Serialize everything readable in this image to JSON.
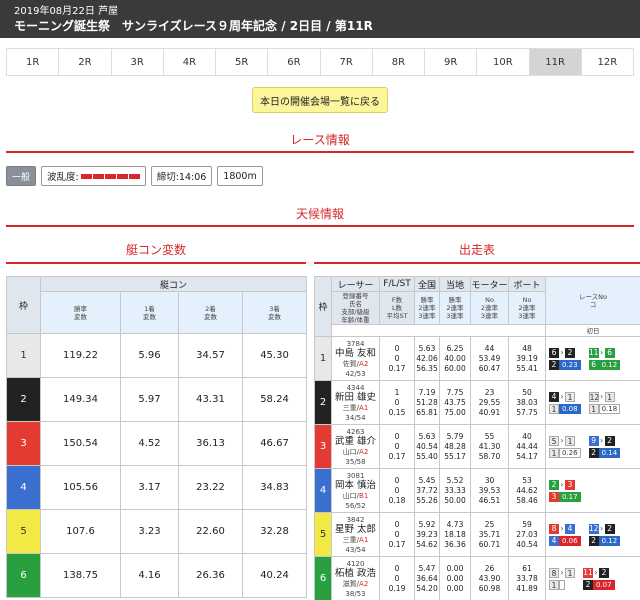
{
  "header": {
    "date_place": "2019年08月22日 芦屋",
    "title": "モーニング誕生祭　サンライズレース９周年記念 / 2日目 / 第11R"
  },
  "race_tabs": [
    "1R",
    "2R",
    "3R",
    "4R",
    "5R",
    "6R",
    "7R",
    "8R",
    "9R",
    "10R",
    "11R",
    "12R"
  ],
  "active_tab": "11R",
  "back_button": "本日の開催会場一覧に戻る",
  "sections": {
    "race_info": "レース情報",
    "weather": "天候情報",
    "boatcon": "艇コン変数",
    "entries": "出走表"
  },
  "race_chips": {
    "grade": "一般",
    "nami_label": "波乱度:",
    "nami_level": 5,
    "deadline": "締切:14:06",
    "distance": "1800m"
  },
  "left_table": {
    "header_waku": "枠",
    "header_group": "艇コン",
    "cols": [
      "勝率\n変数",
      "1着\n変数",
      "2着\n変数",
      "3着\n変数"
    ],
    "rows": [
      {
        "waku": "1",
        "v": [
          "119.22",
          "5.96",
          "34.57",
          "45.30"
        ]
      },
      {
        "waku": "2",
        "v": [
          "149.34",
          "5.97",
          "43.31",
          "58.24"
        ]
      },
      {
        "waku": "3",
        "v": [
          "150.54",
          "4.52",
          "36.13",
          "46.67"
        ]
      },
      {
        "waku": "4",
        "v": [
          "105.56",
          "3.17",
          "23.22",
          "34.83"
        ]
      },
      {
        "waku": "5",
        "v": [
          "107.6",
          "3.23",
          "22.60",
          "32.28"
        ]
      },
      {
        "waku": "6",
        "v": [
          "138.75",
          "4.16",
          "26.36",
          "40.24"
        ]
      }
    ]
  },
  "right_table": {
    "headers": {
      "waku": "枠",
      "racer": "レーサー",
      "fls": "F/L/ST",
      "national": "全国",
      "local": "当地",
      "motor": "モーター",
      "boat": "ボート",
      "last": "レースNo\nコ",
      "racer_sub": "登録番号\n氏名\n支部/級級\n年齢/体重",
      "fls_sub": "F数\nL数\n平均ST",
      "nat_sub": "勝率\n2連率\n3連率",
      "loc_sub": "勝率\n2連率\n3連率",
      "motor_sub": "No\n2連率\n3連率",
      "boat_sub": "No\n2連率\n3連率",
      "day1": "初日"
    },
    "rows": [
      {
        "waku": "1",
        "no": "3784",
        "name": "中島 友和",
        "branch": "佐賀/",
        "cls": "A2",
        "age": "42/53",
        "fls": [
          "0",
          "0",
          "0.17"
        ],
        "nat": [
          "5.63",
          "42.06",
          "56.35"
        ],
        "loc": [
          "6.25",
          "40.00",
          "60.00"
        ],
        "motor": [
          "44",
          "53.49",
          "60.47"
        ],
        "boat": [
          "48",
          "39.19",
          "55.41"
        ],
        "last": [
          [
            {
              "b": "6",
              "c": "b2"
            },
            {
              "b": "2",
              "c": "b2"
            },
            {
              "v": "0.23",
              "t": "blue"
            }
          ],
          [
            {
              "b": "11",
              "c": "b6"
            },
            {
              "b": "6",
              "c": "b6"
            },
            {
              "v": "0.12",
              "t": "green"
            }
          ]
        ]
      },
      {
        "waku": "2",
        "no": "4344",
        "name": "新田 雄史",
        "branch": "三重/",
        "cls": "A1",
        "age": "34/54",
        "fls": [
          "1",
          "0",
          "0.15"
        ],
        "nat": [
          "7.19",
          "51.28",
          "65.81"
        ],
        "loc": [
          "7.75",
          "43.75",
          "75.00"
        ],
        "motor": [
          "23",
          "29.55",
          "40.91"
        ],
        "boat": [
          "50",
          "38.03",
          "57.75"
        ],
        "last": [
          [
            {
              "b": "4",
              "c": "b2"
            },
            {
              "b": "1",
              "c": "b1"
            },
            {
              "v": "0.08",
              "t": "blue"
            }
          ],
          [
            {
              "b": "12",
              "c": "b1"
            },
            {
              "b": "1",
              "c": "b1"
            },
            {
              "v": "0.18",
              "t": ""
            }
          ]
        ]
      },
      {
        "waku": "3",
        "no": "4263",
        "name": "武重 雄介",
        "branch": "山口/",
        "cls": "A2",
        "age": "35/58",
        "fls": [
          "0",
          "0",
          "0.17"
        ],
        "nat": [
          "5.63",
          "40.54",
          "55.40"
        ],
        "loc": [
          "5.79",
          "48.28",
          "55.17"
        ],
        "motor": [
          "55",
          "41.30",
          "58.70"
        ],
        "boat": [
          "40",
          "44.44",
          "54.17"
        ],
        "last": [
          [
            {
              "b": "5",
              "c": "b1"
            },
            {
              "b": "1",
              "c": "b1"
            },
            {
              "v": "0.26",
              "t": ""
            }
          ],
          [
            {
              "b": "9",
              "c": "b4"
            },
            {
              "b": "2",
              "c": "b2"
            },
            {
              "v": "0.14",
              "t": "blue"
            }
          ]
        ]
      },
      {
        "waku": "4",
        "no": "3081",
        "name": "岡本 慎治",
        "branch": "山口/",
        "cls": "B1",
        "age": "56/52",
        "fls": [
          "0",
          "0",
          "0.18"
        ],
        "nat": [
          "5.45",
          "37.72",
          "55.26"
        ],
        "loc": [
          "5.52",
          "33.33",
          "50.00"
        ],
        "motor": [
          "30",
          "39.53",
          "46.51"
        ],
        "boat": [
          "53",
          "44.62",
          "58.46"
        ],
        "last": [
          [
            {
              "b": "2",
              "c": "b6"
            },
            {
              "b": "3",
              "c": "b3"
            },
            {
              "v": "0.17",
              "t": "green"
            }
          ]
        ]
      },
      {
        "waku": "5",
        "no": "3842",
        "name": "星野 太郎",
        "branch": "三重/",
        "cls": "A1",
        "age": "43/54",
        "fls": [
          "0",
          "0",
          "0.17"
        ],
        "nat": [
          "5.92",
          "39.23",
          "54.62"
        ],
        "loc": [
          "4.73",
          "18.18",
          "36.36"
        ],
        "motor": [
          "25",
          "35.71",
          "60.71"
        ],
        "boat": [
          "59",
          "27.03",
          "40.54"
        ],
        "last": [
          [
            {
              "b": "8",
              "c": "b3"
            },
            {
              "b": "4",
              "c": "b4"
            },
            {
              "v": "0.06",
              "t": "red"
            }
          ],
          [
            {
              "b": "12",
              "c": "b4"
            },
            {
              "b": "2",
              "c": "b2"
            },
            {
              "v": "0.12",
              "t": "blue"
            }
          ]
        ]
      },
      {
        "waku": "6",
        "no": "4120",
        "name": "柘植 政浩",
        "branch": "滋賀/",
        "cls": "A2",
        "age": "38/53",
        "fls": [
          "0",
          "0",
          "0.19"
        ],
        "nat": [
          "5.47",
          "36.64",
          "54.20"
        ],
        "loc": [
          "0.00",
          "0.00",
          "0.00"
        ],
        "motor": [
          "26",
          "43.90",
          "60.98"
        ],
        "boat": [
          "61",
          "33.78",
          "41.89"
        ],
        "last": [
          [
            {
              "b": "8",
              "c": "b1"
            },
            {
              "b": "1",
              "c": "b1"
            },
            {
              "v": "",
              "t": ""
            }
          ],
          [
            {
              "b": "11",
              "c": "b3"
            },
            {
              "b": "2",
              "c": "b2"
            },
            {
              "v": "0.07",
              "t": "red"
            }
          ]
        ]
      }
    ]
  }
}
